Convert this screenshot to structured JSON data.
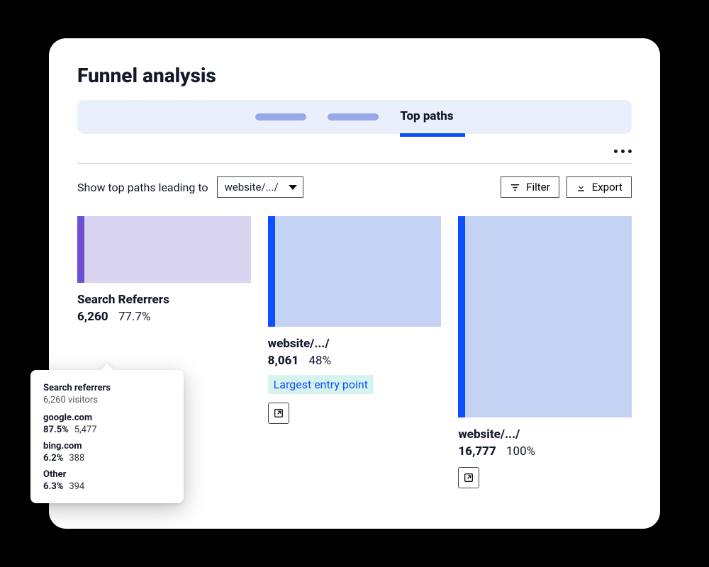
{
  "header": {
    "title": "Funnel analysis"
  },
  "tabs": {
    "active_label": "Top paths"
  },
  "controls": {
    "prompt": "Show top paths leading to",
    "select_value": "website/.../",
    "filter_label": "Filter",
    "export_label": "Export"
  },
  "funnel": {
    "cols": [
      {
        "title": "Search Referrers",
        "count": "6,260",
        "pct": "77.7%"
      },
      {
        "title": "website/.../",
        "count": "8,061",
        "pct": "48%",
        "badge": "Largest entry point"
      },
      {
        "title": "website/.../",
        "count": "16,777",
        "pct": "100%"
      }
    ]
  },
  "tooltip": {
    "title": "Search referrers",
    "subtitle": "6,260 visitors",
    "rows": [
      {
        "domain": "google.com",
        "pct": "87.5%",
        "count": "5,477"
      },
      {
        "domain": "bing.com",
        "pct": "6.2%",
        "count": "388"
      },
      {
        "domain": "Other",
        "pct": "6.3%",
        "count": "394"
      }
    ]
  },
  "chart_data": {
    "type": "bar",
    "title": "Top paths funnel",
    "series": [
      {
        "name": "Search Referrers",
        "visitors": 6260,
        "percent": 77.7
      },
      {
        "name": "website/.../",
        "visitors": 8061,
        "percent": 48
      },
      {
        "name": "website/.../",
        "visitors": 16777,
        "percent": 100
      }
    ],
    "breakdown_of_first_step": [
      {
        "name": "google.com",
        "visitors": 5477,
        "percent": 87.5
      },
      {
        "name": "bing.com",
        "visitors": 388,
        "percent": 6.2
      },
      {
        "name": "Other",
        "visitors": 394,
        "percent": 6.3
      }
    ]
  }
}
